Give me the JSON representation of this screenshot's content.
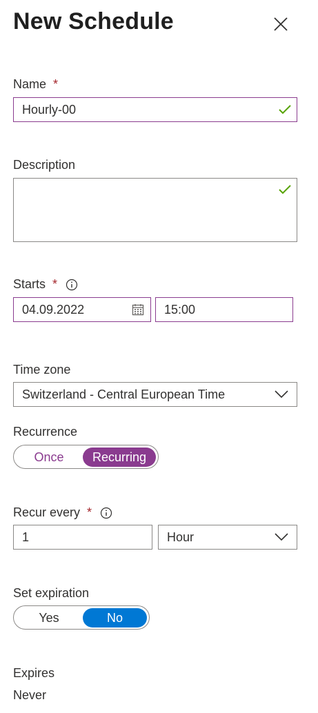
{
  "header": {
    "title": "New Schedule",
    "close_icon": "close-icon"
  },
  "name": {
    "label": "Name",
    "required_mark": "*",
    "value": "Hourly-00",
    "valid": true
  },
  "description": {
    "label": "Description",
    "value": "",
    "valid": true
  },
  "starts": {
    "label": "Starts",
    "required_mark": "*",
    "info_icon": "info-icon",
    "date": "04.09.2022",
    "calendar_icon": "calendar-icon",
    "time": "15:00"
  },
  "time_zone": {
    "label": "Time zone",
    "value": "Switzerland - Central European Time"
  },
  "recurrence": {
    "label": "Recurrence",
    "options": [
      "Once",
      "Recurring"
    ],
    "selected": "Recurring"
  },
  "recur_every": {
    "label": "Recur every",
    "required_mark": "*",
    "info_icon": "info-icon",
    "interval": "1",
    "unit": "Hour"
  },
  "set_expiration": {
    "label": "Set expiration",
    "options": [
      "Yes",
      "No"
    ],
    "selected": "No"
  },
  "expires": {
    "label": "Expires",
    "value": "Never"
  },
  "colors": {
    "accent_purple": "#8a3b8f",
    "accent_blue": "#0078d4",
    "valid_green": "#57a300",
    "required_red": "#a4262c"
  }
}
